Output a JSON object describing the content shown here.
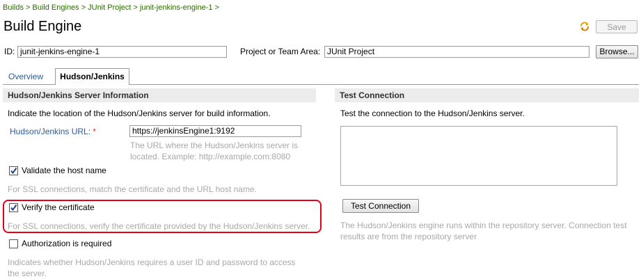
{
  "breadcrumb": [
    "Builds",
    "Build Engines",
    "JUnit Project",
    "junit-jenkins-engine-1"
  ],
  "breadcrumb_separator": ">",
  "page_title": "Build Engine",
  "toolbar": {
    "save_label": "Save",
    "refresh_icon": "refresh-icon"
  },
  "id_field": {
    "label": "ID:",
    "value": "junit-jenkins-engine-1"
  },
  "project_field": {
    "label": "Project or Team Area:",
    "value": "JUnit Project",
    "browse_label": "Browse..."
  },
  "tabs": [
    {
      "label": "Overview",
      "active": false
    },
    {
      "label": "Hudson/Jenkins",
      "active": true
    }
  ],
  "server_section": {
    "header": "Hudson/Jenkins Server Information",
    "description": "Indicate the location of the Hudson/Jenkins server for build information.",
    "url_label": "Hudson/Jenkins URL:",
    "required_marker": "*",
    "url_value": "https://jenkinsEngine1:9192",
    "url_hint_1": "The URL where the Hudson/Jenkins server is",
    "url_hint_2": "located. Example: http://example.com:8080",
    "validate_host": {
      "label": "Validate the host name",
      "checked": true,
      "hint": "For SSL connections, match the certificate and the URL host name."
    },
    "verify_cert": {
      "label": "Verify the certificate",
      "checked": true,
      "hint": "For SSL connections, verify the certificate provided by the Hudson/Jenkins server."
    },
    "auth_required": {
      "label": "Authorization is required",
      "checked": false,
      "hint_1": "Indicates whether Hudson/Jenkins requires a user ID and password to access",
      "hint_2": "the server."
    }
  },
  "test_section": {
    "header": "Test Connection",
    "description": "Test the connection to the Hudson/Jenkins server.",
    "button_label": "Test Connection",
    "note_1": "The Hudson/Jenkins engine runs within the repository server. Connection test",
    "note_2": "results are from the repository server"
  },
  "colors": {
    "link": "#2a5b9c",
    "breadcrumb": "#2b6a00",
    "highlight": "#e2001a",
    "required": "#d13b1c",
    "hint": "#a8a8a8"
  }
}
